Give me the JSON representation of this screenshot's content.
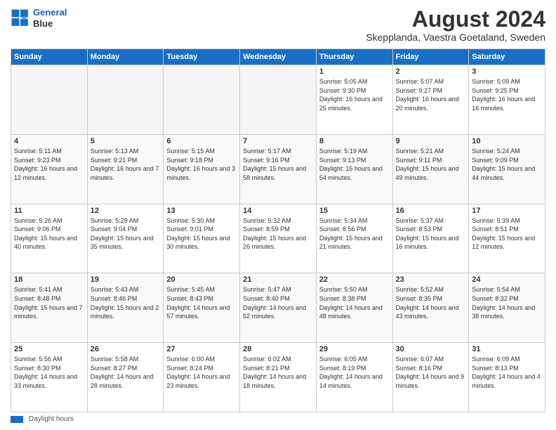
{
  "header": {
    "logo_line1": "General",
    "logo_line2": "Blue",
    "month_title": "August 2024",
    "subtitle": "Skepplanda, Vaestra Goetaland, Sweden"
  },
  "days_of_week": [
    "Sunday",
    "Monday",
    "Tuesday",
    "Wednesday",
    "Thursday",
    "Friday",
    "Saturday"
  ],
  "weeks": [
    [
      {
        "num": "",
        "info": ""
      },
      {
        "num": "",
        "info": ""
      },
      {
        "num": "",
        "info": ""
      },
      {
        "num": "",
        "info": ""
      },
      {
        "num": "1",
        "info": "Sunrise: 5:05 AM\nSunset: 9:30 PM\nDaylight: 16 hours\nand 25 minutes."
      },
      {
        "num": "2",
        "info": "Sunrise: 5:07 AM\nSunset: 9:27 PM\nDaylight: 16 hours\nand 20 minutes."
      },
      {
        "num": "3",
        "info": "Sunrise: 5:09 AM\nSunset: 9:25 PM\nDaylight: 16 hours\nand 16 minutes."
      }
    ],
    [
      {
        "num": "4",
        "info": "Sunrise: 5:11 AM\nSunset: 9:23 PM\nDaylight: 16 hours\nand 12 minutes."
      },
      {
        "num": "5",
        "info": "Sunrise: 5:13 AM\nSunset: 9:21 PM\nDaylight: 16 hours\nand 7 minutes."
      },
      {
        "num": "6",
        "info": "Sunrise: 5:15 AM\nSunset: 9:18 PM\nDaylight: 16 hours\nand 3 minutes."
      },
      {
        "num": "7",
        "info": "Sunrise: 5:17 AM\nSunset: 9:16 PM\nDaylight: 15 hours\nand 58 minutes."
      },
      {
        "num": "8",
        "info": "Sunrise: 5:19 AM\nSunset: 9:13 PM\nDaylight: 15 hours\nand 54 minutes."
      },
      {
        "num": "9",
        "info": "Sunrise: 5:21 AM\nSunset: 9:11 PM\nDaylight: 15 hours\nand 49 minutes."
      },
      {
        "num": "10",
        "info": "Sunrise: 5:24 AM\nSunset: 9:09 PM\nDaylight: 15 hours\nand 44 minutes."
      }
    ],
    [
      {
        "num": "11",
        "info": "Sunrise: 5:26 AM\nSunset: 9:06 PM\nDaylight: 15 hours\nand 40 minutes."
      },
      {
        "num": "12",
        "info": "Sunrise: 5:28 AM\nSunset: 9:04 PM\nDaylight: 15 hours\nand 35 minutes."
      },
      {
        "num": "13",
        "info": "Sunrise: 5:30 AM\nSunset: 9:01 PM\nDaylight: 15 hours\nand 30 minutes."
      },
      {
        "num": "14",
        "info": "Sunrise: 5:32 AM\nSunset: 8:59 PM\nDaylight: 15 hours\nand 26 minutes."
      },
      {
        "num": "15",
        "info": "Sunrise: 5:34 AM\nSunset: 8:56 PM\nDaylight: 15 hours\nand 21 minutes."
      },
      {
        "num": "16",
        "info": "Sunrise: 5:37 AM\nSunset: 8:53 PM\nDaylight: 15 hours\nand 16 minutes."
      },
      {
        "num": "17",
        "info": "Sunrise: 5:39 AM\nSunset: 8:51 PM\nDaylight: 15 hours\nand 12 minutes."
      }
    ],
    [
      {
        "num": "18",
        "info": "Sunrise: 5:41 AM\nSunset: 8:48 PM\nDaylight: 15 hours\nand 7 minutes."
      },
      {
        "num": "19",
        "info": "Sunrise: 5:43 AM\nSunset: 8:46 PM\nDaylight: 15 hours\nand 2 minutes."
      },
      {
        "num": "20",
        "info": "Sunrise: 5:45 AM\nSunset: 8:43 PM\nDaylight: 14 hours\nand 57 minutes."
      },
      {
        "num": "21",
        "info": "Sunrise: 5:47 AM\nSunset: 8:40 PM\nDaylight: 14 hours\nand 52 minutes."
      },
      {
        "num": "22",
        "info": "Sunrise: 5:50 AM\nSunset: 8:38 PM\nDaylight: 14 hours\nand 48 minutes."
      },
      {
        "num": "23",
        "info": "Sunrise: 5:52 AM\nSunset: 8:35 PM\nDaylight: 14 hours\nand 43 minutes."
      },
      {
        "num": "24",
        "info": "Sunrise: 5:54 AM\nSunset: 8:32 PM\nDaylight: 14 hours\nand 38 minutes."
      }
    ],
    [
      {
        "num": "25",
        "info": "Sunrise: 5:56 AM\nSunset: 8:30 PM\nDaylight: 14 hours\nand 33 minutes."
      },
      {
        "num": "26",
        "info": "Sunrise: 5:58 AM\nSunset: 8:27 PM\nDaylight: 14 hours\nand 28 minutes."
      },
      {
        "num": "27",
        "info": "Sunrise: 6:00 AM\nSunset: 8:24 PM\nDaylight: 14 hours\nand 23 minutes."
      },
      {
        "num": "28",
        "info": "Sunrise: 6:02 AM\nSunset: 8:21 PM\nDaylight: 14 hours\nand 18 minutes."
      },
      {
        "num": "29",
        "info": "Sunrise: 6:05 AM\nSunset: 8:19 PM\nDaylight: 14 hours\nand 14 minutes."
      },
      {
        "num": "30",
        "info": "Sunrise: 6:07 AM\nSunset: 8:16 PM\nDaylight: 14 hours\nand 9 minutes."
      },
      {
        "num": "31",
        "info": "Sunrise: 6:09 AM\nSunset: 8:13 PM\nDaylight: 14 hours\nand 4 minutes."
      }
    ]
  ],
  "footer": {
    "label": "Daylight hours"
  }
}
